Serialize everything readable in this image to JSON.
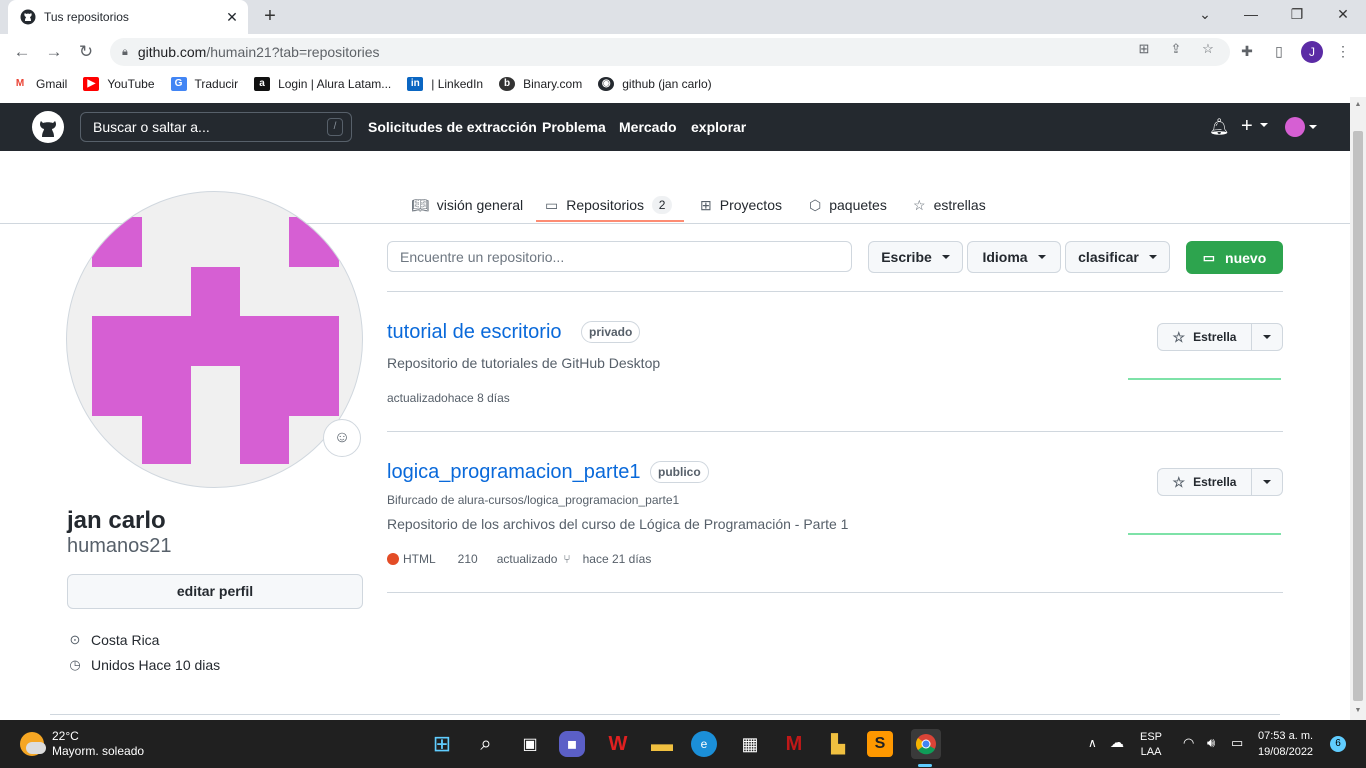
{
  "browser": {
    "tab_title": "Tus repositorios",
    "url_host": "github.com",
    "url_path": "/humain21?tab=repositories",
    "profile_initial": "J",
    "bookmarks": [
      {
        "label": "Gmail",
        "icon": "gmail-icon",
        "color": "#ea4335"
      },
      {
        "label": "YouTube",
        "icon": "youtube-icon",
        "color": "#ff0000"
      },
      {
        "label": "Traducir",
        "icon": "translate-icon",
        "color": "#4285f4"
      },
      {
        "label": "Login | Alura Latam...",
        "icon": "alura-icon",
        "color": "#111111"
      },
      {
        "label": "| LinkedIn",
        "icon": "linkedin-icon",
        "color": "#0a66c2"
      },
      {
        "label": "Binary.com",
        "icon": "binary-icon",
        "color": "#333333"
      },
      {
        "label": "github (jan carlo)",
        "icon": "github-icon",
        "color": "#24292f"
      }
    ]
  },
  "gh_header": {
    "search_placeholder": "Buscar o saltar a...",
    "search_kbd": "/",
    "nav": [
      "Solicitudes de extracción",
      "Problema",
      "Mercado",
      "explorar"
    ]
  },
  "profile_tabs": [
    {
      "label": "visión general",
      "icon": "book-icon"
    },
    {
      "label": "Repositorios",
      "icon": "repo-icon",
      "count": "2"
    },
    {
      "label": "Proyectos",
      "icon": "table-icon"
    },
    {
      "label": "paquetes",
      "icon": "package-icon"
    },
    {
      "label": "estrellas",
      "icon": "star-icon"
    }
  ],
  "profile": {
    "name": "jan carlo",
    "username": "humanos21",
    "edit_label": "editar perfil",
    "location": "Costa Rica",
    "joined": "Unidos Hace 10 dias",
    "avatar_color": "#d65fd3"
  },
  "filters": {
    "search_placeholder": "Encuentre un repositorio...",
    "type_label": "Escribe",
    "language_label": "Idioma",
    "sort_label": "clasificar",
    "new_label": "nuevo"
  },
  "repos": [
    {
      "name": "tutorial de escritorio",
      "visibility": "privado",
      "forked_from": "",
      "description": "Repositorio de tutoriales de GitHub Desktop",
      "updated": "actualizadohace 8 días",
      "star_label": "Estrella"
    },
    {
      "name": "logica_programacion_parte1",
      "visibility": "publico",
      "forked_from": "Bifurcado de alura-cursos/logica_programacion_parte1",
      "description": "Repositorio de los archivos del curso de Lógica de Programación - Parte 1",
      "language": "HTML",
      "language_color": "#e34c26",
      "forks": "210",
      "updated_label": "actualizado",
      "updated_when": "hace 21 días",
      "star_label": "Estrella"
    }
  ],
  "taskbar": {
    "weather_temp": "22°C",
    "weather_desc": "Mayorm. soleado",
    "lang_line1": "ESP",
    "lang_line2": "LAA",
    "time": "07:53 a. m.",
    "date": "19/08/2022",
    "notifications": "6"
  }
}
